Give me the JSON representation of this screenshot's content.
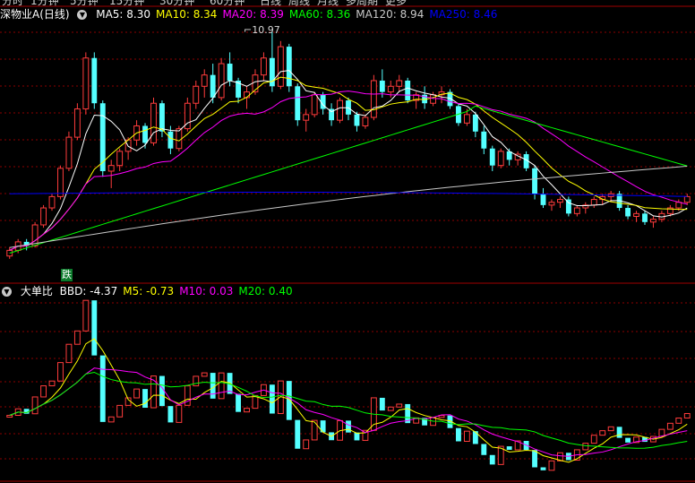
{
  "period_tabs": [
    "分时",
    "1分钟",
    "5分钟",
    "15分钟",
    "30分钟",
    "60分钟",
    "日线",
    "周线",
    "月线",
    "多周期",
    "更多"
  ],
  "main_panel": {
    "stock_title": "深物业A(日线)",
    "indicators": [
      {
        "label": "MA5: 8.30",
        "color": "#ffffff"
      },
      {
        "label": "MA10: 8.34",
        "color": "#ffff00"
      },
      {
        "label": "MA20: 8.39",
        "color": "#ff00ff"
      },
      {
        "label": "MA60: 8.36",
        "color": "#00ff00"
      },
      {
        "label": "MA120: 8.94",
        "color": "#c8c8c8"
      },
      {
        "label": "MA250: 8.46",
        "color": "#0000ff"
      }
    ],
    "high_marker": "10.97",
    "badge": "跌"
  },
  "sub_panel": {
    "indicator_name": "大单比",
    "indicators": [
      {
        "label": "BBD: -4.37",
        "color": "#ffffff"
      },
      {
        "label": "M5: -0.73",
        "color": "#ffff00"
      },
      {
        "label": "M10: 0.03",
        "color": "#ff00ff"
      },
      {
        "label": "M20: 0.40",
        "color": "#00ff00"
      }
    ]
  },
  "colors": {
    "up": "#ff3c3c",
    "down": "#54ffff",
    "grid": "#8b0000",
    "border": "#a00000"
  },
  "chart_data": [
    {
      "type": "candlestick",
      "title": "深物业A(日线)",
      "candles": [
        [
          7.0,
          7.15,
          6.95,
          7.1
        ],
        [
          7.1,
          7.3,
          7.05,
          7.25
        ],
        [
          7.25,
          7.3,
          7.1,
          7.18
        ],
        [
          7.18,
          7.6,
          7.15,
          7.55
        ],
        [
          7.55,
          7.9,
          7.5,
          7.85
        ],
        [
          7.85,
          8.1,
          7.8,
          8.05
        ],
        [
          8.05,
          8.6,
          8.0,
          8.55
        ],
        [
          8.55,
          9.2,
          8.5,
          9.1
        ],
        [
          9.1,
          9.7,
          9.05,
          9.6
        ],
        [
          9.6,
          10.6,
          9.5,
          10.5
        ],
        [
          10.5,
          10.6,
          9.6,
          9.7
        ],
        [
          9.7,
          9.75,
          8.4,
          8.5
        ],
        [
          8.5,
          8.7,
          8.2,
          8.6
        ],
        [
          8.6,
          8.9,
          8.5,
          8.85
        ],
        [
          8.85,
          9.1,
          8.7,
          9.05
        ],
        [
          9.05,
          9.4,
          8.95,
          9.3
        ],
        [
          9.3,
          9.35,
          8.9,
          9.0
        ],
        [
          9.0,
          9.8,
          8.95,
          9.7
        ],
        [
          9.7,
          9.75,
          9.1,
          9.2
        ],
        [
          9.2,
          9.3,
          8.8,
          8.9
        ],
        [
          8.9,
          9.3,
          8.85,
          9.25
        ],
        [
          9.25,
          9.8,
          9.2,
          9.7
        ],
        [
          9.7,
          10.1,
          9.6,
          10.0
        ],
        [
          10.0,
          10.3,
          9.8,
          10.2
        ],
        [
          10.2,
          10.4,
          9.7,
          9.8
        ],
        [
          9.8,
          10.5,
          9.75,
          10.4
        ],
        [
          10.4,
          10.6,
          10.0,
          10.1
        ],
        [
          10.1,
          10.15,
          9.7,
          9.8
        ],
        [
          9.8,
          10.0,
          9.6,
          9.9
        ],
        [
          9.9,
          10.3,
          9.85,
          10.2
        ],
        [
          10.2,
          10.6,
          10.1,
          10.5
        ],
        [
          10.5,
          10.97,
          9.9,
          10.0
        ],
        [
          10.0,
          10.8,
          9.95,
          10.7
        ],
        [
          10.7,
          10.75,
          9.9,
          10.0
        ],
        [
          10.0,
          10.05,
          9.3,
          9.4
        ],
        [
          9.4,
          9.6,
          9.2,
          9.5
        ],
        [
          9.5,
          9.9,
          9.45,
          9.85
        ],
        [
          9.85,
          9.9,
          9.5,
          9.6
        ],
        [
          9.6,
          9.7,
          9.3,
          9.4
        ],
        [
          9.4,
          9.8,
          9.35,
          9.75
        ],
        [
          9.75,
          9.8,
          9.4,
          9.5
        ],
        [
          9.5,
          9.55,
          9.2,
          9.3
        ],
        [
          9.3,
          9.5,
          9.25,
          9.45
        ],
        [
          9.45,
          10.2,
          9.4,
          10.1
        ],
        [
          10.1,
          10.3,
          9.8,
          9.9
        ],
        [
          9.9,
          10.1,
          9.8,
          10.0
        ],
        [
          10.0,
          10.2,
          9.9,
          10.1
        ],
        [
          10.1,
          10.15,
          9.7,
          9.75
        ],
        [
          9.75,
          9.9,
          9.6,
          9.85
        ],
        [
          9.85,
          10.0,
          9.6,
          9.7
        ],
        [
          9.7,
          9.9,
          9.65,
          9.85
        ],
        [
          9.85,
          10.0,
          9.7,
          9.9
        ],
        [
          9.9,
          9.95,
          9.6,
          9.65
        ],
        [
          9.65,
          9.7,
          9.3,
          9.35
        ],
        [
          9.35,
          9.6,
          9.3,
          9.5
        ],
        [
          9.5,
          9.55,
          9.1,
          9.2
        ],
        [
          9.2,
          9.3,
          8.8,
          8.9
        ],
        [
          8.9,
          8.95,
          8.5,
          8.6
        ],
        [
          8.6,
          8.9,
          8.55,
          8.85
        ],
        [
          8.85,
          8.9,
          8.6,
          8.7
        ],
        [
          8.7,
          8.85,
          8.6,
          8.8
        ],
        [
          8.8,
          8.85,
          8.5,
          8.55
        ],
        [
          8.55,
          8.6,
          8.0,
          8.1
        ],
        [
          8.1,
          8.2,
          7.85,
          7.9
        ],
        [
          7.9,
          8.0,
          7.8,
          7.95
        ],
        [
          7.95,
          8.05,
          7.85,
          8.0
        ],
        [
          8.0,
          8.05,
          7.7,
          7.75
        ],
        [
          7.75,
          7.9,
          7.7,
          7.85
        ],
        [
          7.85,
          7.95,
          7.75,
          7.9
        ],
        [
          7.9,
          8.05,
          7.85,
          8.0
        ],
        [
          8.0,
          8.1,
          7.9,
          8.05
        ],
        [
          8.05,
          8.15,
          7.95,
          8.1
        ],
        [
          8.1,
          8.15,
          7.8,
          7.85
        ],
        [
          7.85,
          7.9,
          7.65,
          7.7
        ],
        [
          7.7,
          7.8,
          7.6,
          7.75
        ],
        [
          7.75,
          7.8,
          7.55,
          7.6
        ],
        [
          7.6,
          7.7,
          7.5,
          7.65
        ],
        [
          7.65,
          7.8,
          7.6,
          7.75
        ],
        [
          7.75,
          7.9,
          7.7,
          7.85
        ],
        [
          7.85,
          8.0,
          7.8,
          7.95
        ],
        [
          7.95,
          8.1,
          7.9,
          8.05
        ]
      ],
      "ma_levels_latest": {
        "MA5": 8.3,
        "MA10": 8.34,
        "MA20": 8.39,
        "MA60": 8.36,
        "MA120": 8.94,
        "MA250": 8.46
      },
      "grid": true
    },
    {
      "type": "candlestick",
      "title": "大单比",
      "series_latest": {
        "BBD": -4.37,
        "M5": -0.73,
        "M10": 0.03,
        "M20": 0.4
      },
      "grid": true
    }
  ]
}
